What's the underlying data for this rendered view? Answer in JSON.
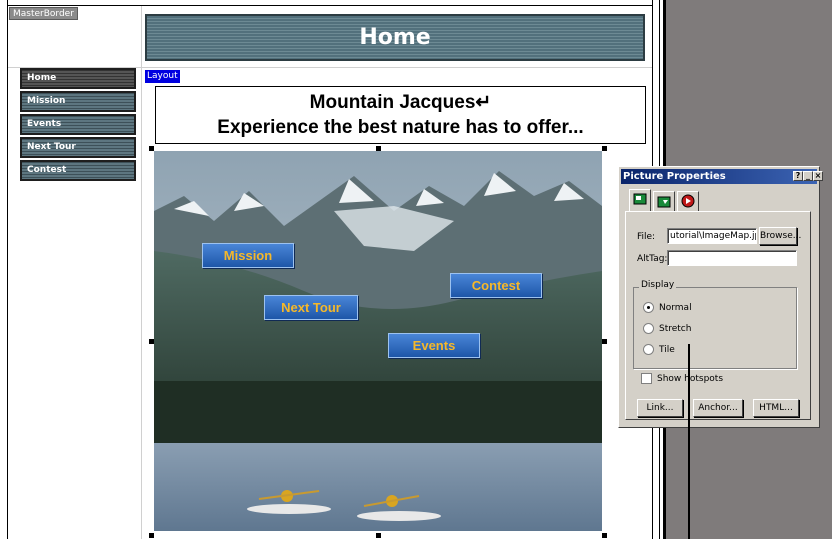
{
  "master_border_label": "MasterBorder",
  "banner_title": "Home",
  "nav": {
    "items": [
      {
        "label": "Home"
      },
      {
        "label": "Mission"
      },
      {
        "label": "Events"
      },
      {
        "label": "Next Tour"
      },
      {
        "label": "Contest"
      }
    ]
  },
  "layout_tag": "Layout",
  "heading": {
    "line1": "Mountain Jacques↵",
    "line2": "Experience the best nature has to offer..."
  },
  "image_hotspots": {
    "mission": "Mission",
    "next_tour": "Next Tour",
    "contest": "Contest",
    "events": "Events"
  },
  "dialog": {
    "title": "Picture Properties",
    "file_label": "File:",
    "file_value": "utorial\\ImageMap.jpg",
    "browse_label": "Browse...",
    "alt_tag_label": "AltTag:",
    "alt_tag_value": "",
    "display_legend": "Display",
    "display_options": [
      "Normal",
      "Stretch",
      "Tile"
    ],
    "display_selected": "Normal",
    "show_hotspots_label": "Show hotspots",
    "show_hotspots_checked": false,
    "link_label": "Link...",
    "anchor_label": "Anchor...",
    "html_label": "HTML..."
  },
  "colors": {
    "banner": "#52707c",
    "nav": "#4a5e66",
    "dialog_title": "#0a246a",
    "dialog_face": "#d4d0c8",
    "workspace_gray": "#7f7b7b",
    "hotspot_blue": "#2a66c0",
    "hotspot_text": "#f5b82a"
  }
}
